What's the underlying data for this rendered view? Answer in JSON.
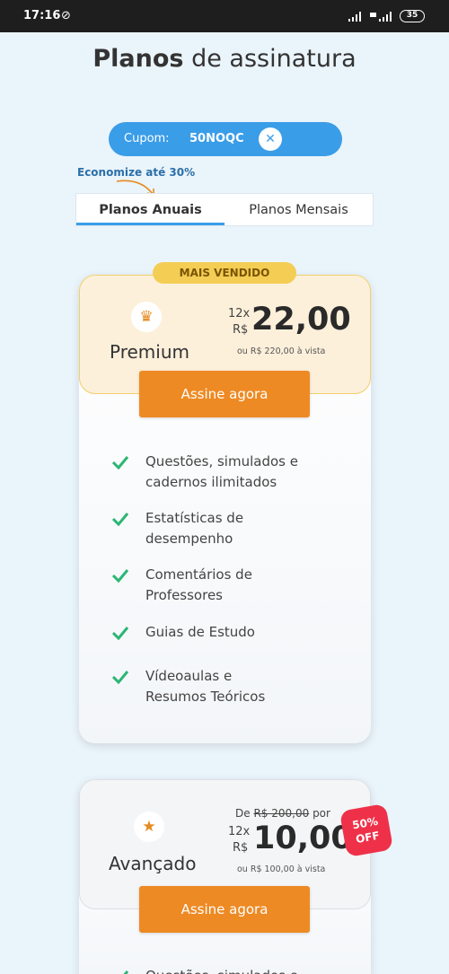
{
  "statusbar": {
    "time": "17:16",
    "battery": "35"
  },
  "page": {
    "title_bold": "Planos",
    "title_rest": "de assinatura"
  },
  "coupon": {
    "label": "Cupom:",
    "code": "50NOQC"
  },
  "savings_note": "Economize até 30%",
  "tabs": [
    {
      "label": "Planos Anuais",
      "selected": true
    },
    {
      "label": "Planos Mensais",
      "selected": false
    }
  ],
  "plans": [
    {
      "badge": "MAIS VENDIDO",
      "name": "Premium",
      "installments": "12x",
      "currency": "R$",
      "price": "22,00",
      "cash_price": "ou R$ 220,00 à vista",
      "cta": "Assine agora",
      "icon": "crown-icon",
      "features": [
        "Questões, simulados e cadernos ilimitados",
        "Estatísticas de desempenho",
        "Comentários de Professores",
        "Guias de Estudo",
        "Vídeoaulas e Resumos Teóricos"
      ]
    },
    {
      "name": "Avançado",
      "old_price_prefix": "De",
      "old_price": "R$ 200,00",
      "old_price_suffix": "por",
      "installments": "12x",
      "currency": "R$",
      "price": "10,00",
      "cash_price": "ou R$ 100,00 à vista",
      "discount_line1": "50%",
      "discount_line2": "OFF",
      "cta": "Assine agora",
      "icon": "star-icon",
      "features": [
        "Questões, simulados e"
      ]
    }
  ],
  "colors": {
    "accent": "#3a9de8",
    "cta": "#ee8a23",
    "check": "#2bb673",
    "badge": "#f4cd55",
    "discount": "#ee3149"
  }
}
